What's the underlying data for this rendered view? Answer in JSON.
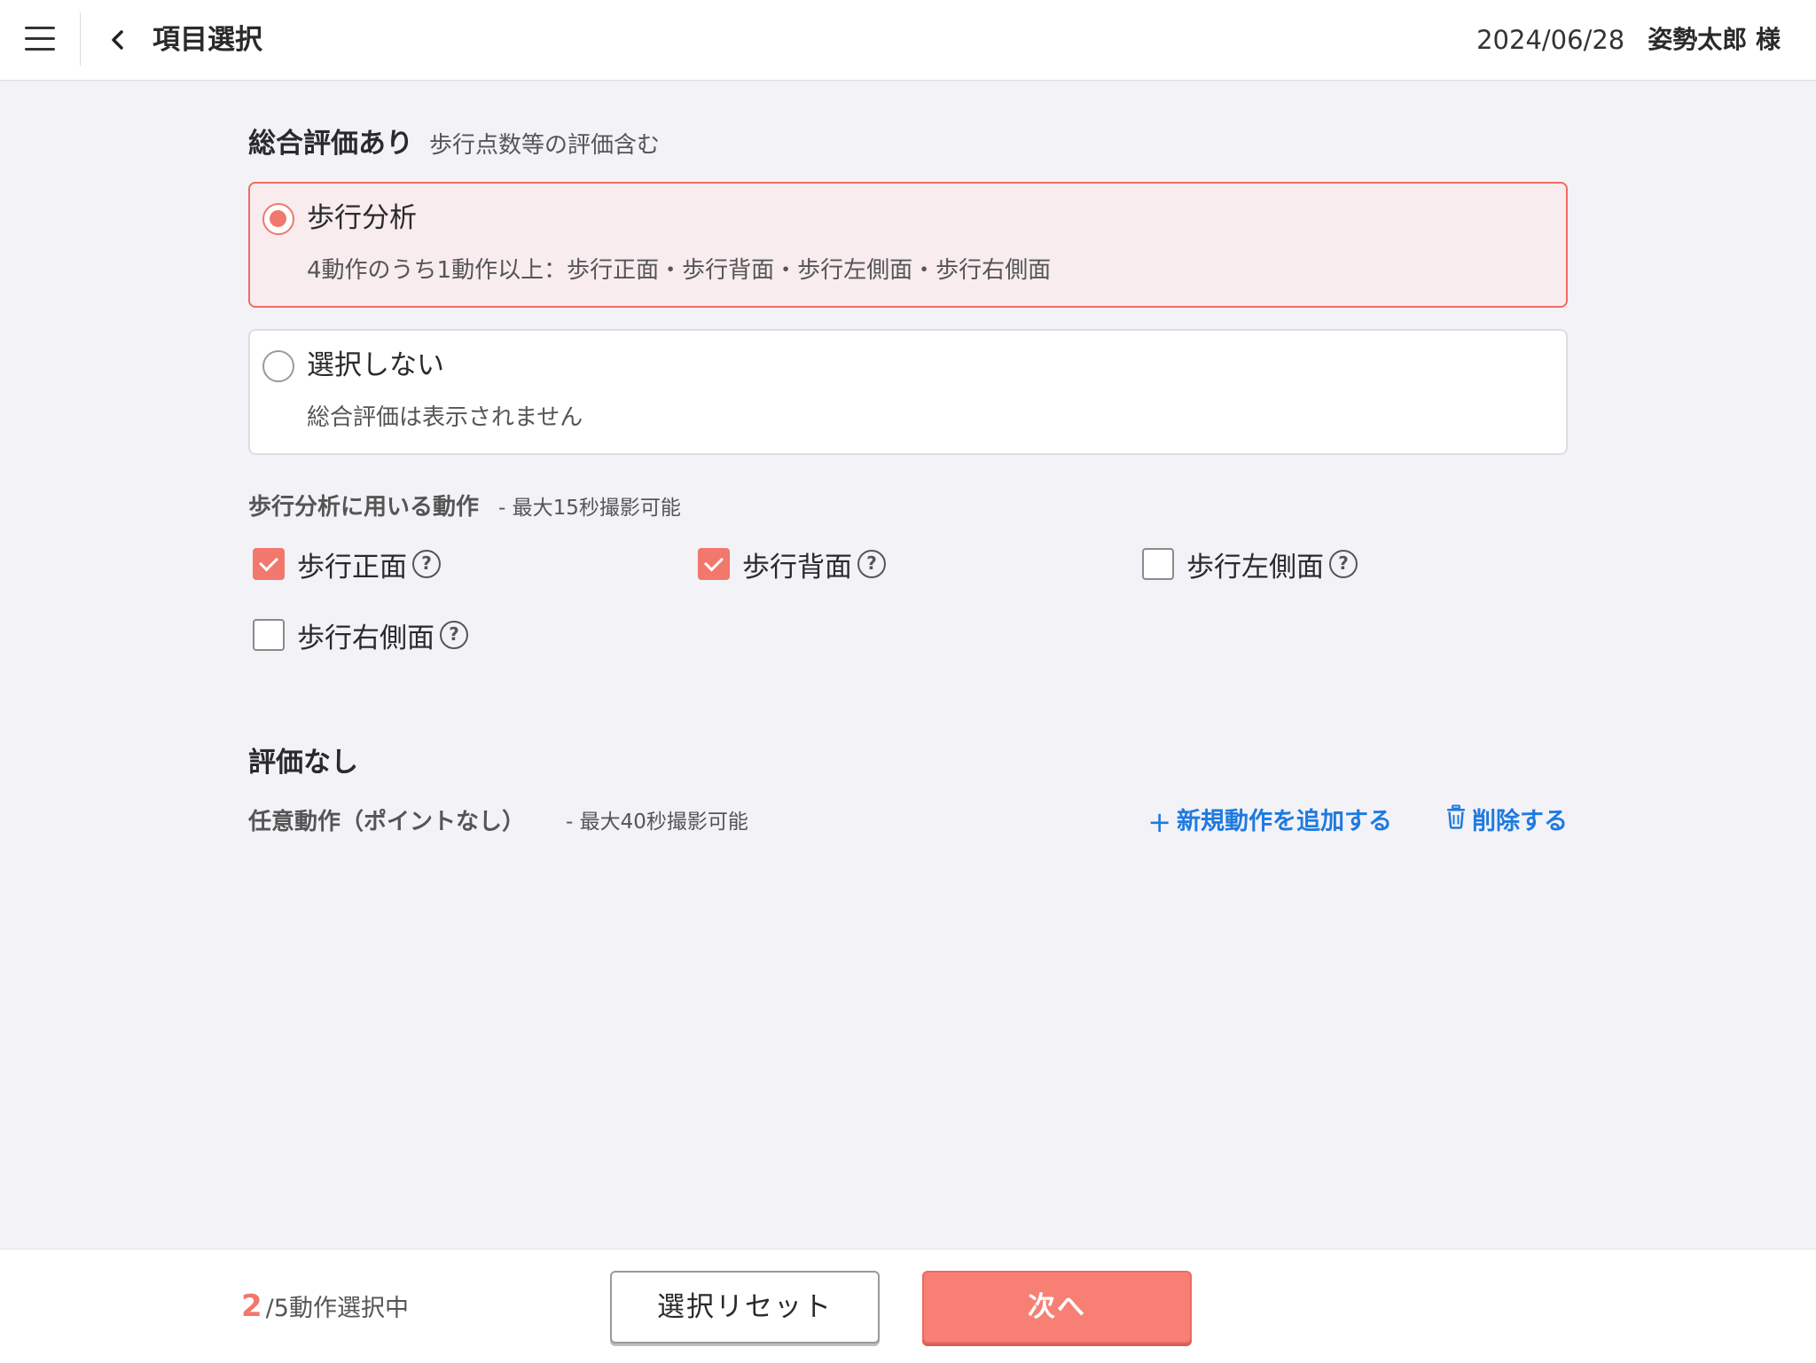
{
  "header": {
    "title": "項目選択",
    "date": "2024/06/28",
    "user": "姿勢太郎 様",
    "icons": [
      "menu-icon",
      "chevron-left-icon"
    ]
  },
  "overall": {
    "title": "総合評価あり",
    "subtitle": "歩行点数等の評価含む",
    "options": [
      {
        "title": "歩行分析",
        "description": "4動作のうち1動作以上：歩行正面・歩行背面・歩行左側面・歩行右側面",
        "selected": true
      },
      {
        "title": "選択しない",
        "description": "総合評価は表示されません",
        "selected": false
      }
    ]
  },
  "motions": {
    "title": "歩行分析に用いる動作",
    "subtitle": "- 最大15秒撮影可能",
    "items": [
      {
        "label": "歩行正面",
        "checked": true
      },
      {
        "label": "歩行背面",
        "checked": true
      },
      {
        "label": "歩行左側面",
        "checked": false
      },
      {
        "label": "歩行右側面",
        "checked": false
      }
    ],
    "help_symbol": "?"
  },
  "no_eval": {
    "title": "評価なし",
    "free_title": "任意動作（ポイントなし）",
    "free_subtitle": "- 最大40秒撮影可能",
    "add_label": "新規動作を追加する",
    "add_symbol": "+",
    "delete_label": "削除する"
  },
  "footer": {
    "count": "2",
    "count_suffix": "/5動作選択中",
    "reset_label": "選択リセット",
    "next_label": "次へ"
  },
  "colors": {
    "accent": "#f2776d",
    "link": "#1f7ae0",
    "background": "#f3f2f7",
    "selected_card_bg": "#f8ecee"
  }
}
